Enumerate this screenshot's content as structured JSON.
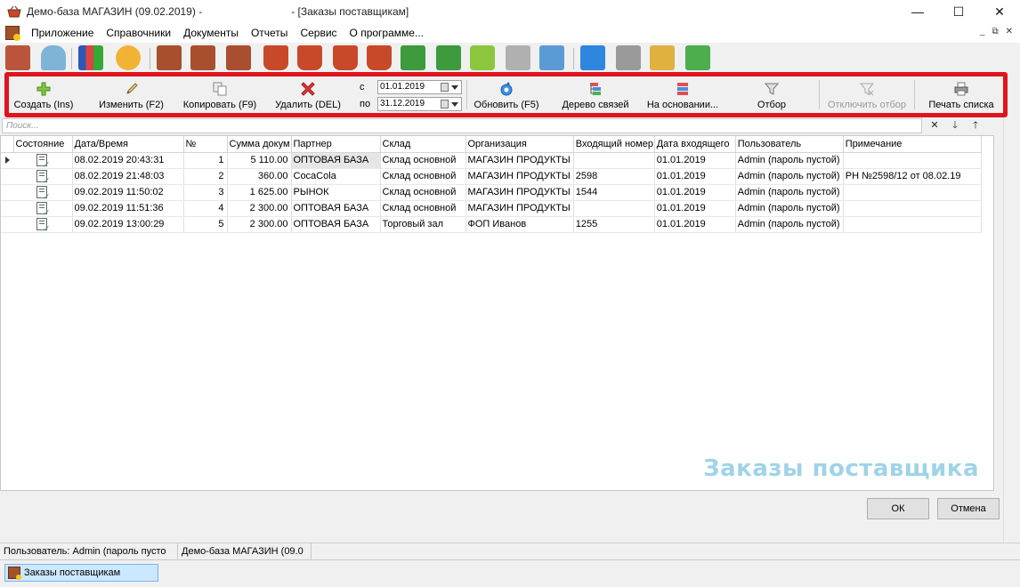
{
  "window": {
    "title": "Демо-база МАГАЗИН (09.02.2019) -                              - [Заказы поставщикам]",
    "minimize": "—",
    "maximize": "☐",
    "close": "✕"
  },
  "menu": {
    "items": [
      "Приложение",
      "Справочники",
      "Документы",
      "Отчеты",
      "Сервис",
      "О программе..."
    ],
    "mdi_controls": [
      "_",
      "⧉",
      "✕"
    ]
  },
  "toolbar": {
    "create": "Создать (Ins)",
    "edit": "Изменить (F2)",
    "copy": "Копировать (F9)",
    "delete": "Удалить (DEL)",
    "date_from_label": "с",
    "date_from": "01.01.2019",
    "date_to_label": "по",
    "date_to": "31.12.2019",
    "refresh": "Обновить (F5)",
    "link_tree": "Дерево связей",
    "based_on": "На основании...",
    "filter": "Отбор",
    "filter_off": "Отключить отбор",
    "print_list": "Печать списка"
  },
  "search": {
    "placeholder": "Поиск..."
  },
  "grid": {
    "columns": [
      "Состояние",
      "Дата/Время",
      "№",
      "Сумма докум",
      "Партнер",
      "Склад",
      "Организация",
      "Входящий номер",
      "Дата входящего",
      "Пользователь",
      "Примечание"
    ],
    "rows": [
      [
        "",
        "08.02.2019 20:43:31",
        "1",
        "5 110.00",
        "ОПТОВАЯ БАЗА",
        "Склад основной",
        "МАГАЗИН ПРОДУКТЫ",
        "",
        "01.01.2019",
        "Admin (пароль пустой)",
        ""
      ],
      [
        "",
        "08.02.2019 21:48:03",
        "2",
        "360.00",
        "CocaCola",
        "Склад основной",
        "МАГАЗИН ПРОДУКТЫ",
        "2598",
        "01.01.2019",
        "Admin (пароль пустой)",
        "РН №2598/12 от 08.02.19"
      ],
      [
        "",
        "09.02.2019 11:50:02",
        "3",
        "1 625.00",
        "РЫНОК",
        "Склад основной",
        "МАГАЗИН ПРОДУКТЫ",
        "1544",
        "01.01.2019",
        "Admin (пароль пустой)",
        ""
      ],
      [
        "",
        "09.02.2019 11:51:36",
        "4",
        "2 300.00",
        "ОПТОВАЯ БАЗА",
        "Склад основной",
        "МАГАЗИН ПРОДУКТЫ",
        "",
        "01.01.2019",
        "Admin (пароль пустой)",
        ""
      ],
      [
        "",
        "09.02.2019 13:00:29",
        "5",
        "2 300.00",
        "ОПТОВАЯ БАЗА",
        "Торговый зал",
        "ФОП Иванов",
        "1255",
        "01.01.2019",
        "Admin (пароль пустой)",
        ""
      ]
    ]
  },
  "watermark": "Заказы поставщика",
  "buttons": {
    "ok": "ОК",
    "cancel": "Отмена"
  },
  "status": {
    "user": "Пользователь: Admin (пароль пусто",
    "db": "Демо-база МАГАЗИН (09.0"
  },
  "taskbar": {
    "tab": "Заказы поставщикам"
  },
  "colors": {
    "highlight": "#e0141e",
    "accent_tab": "#cce8ff",
    "watermark": "#9fd3e8"
  }
}
